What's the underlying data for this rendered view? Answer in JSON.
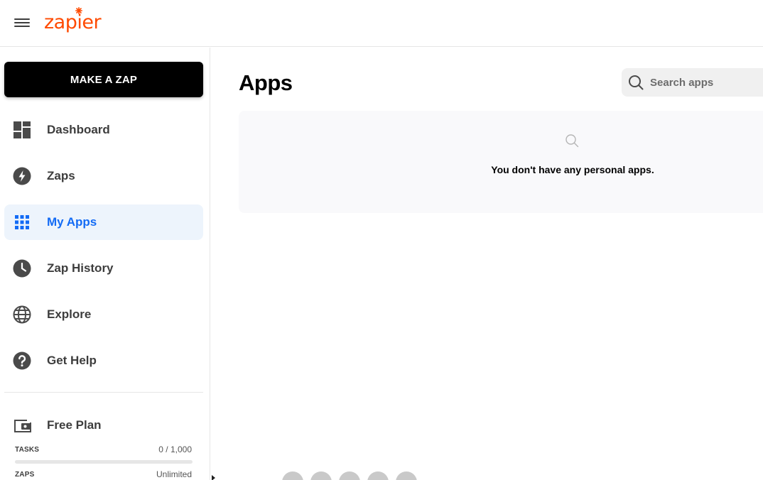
{
  "header": {
    "logo_text": "zapier"
  },
  "sidebar": {
    "make_zap_label": "MAKE A ZAP",
    "items": [
      {
        "label": "Dashboard",
        "icon": "dashboard-icon",
        "active": false
      },
      {
        "label": "Zaps",
        "icon": "bolt-icon",
        "active": false
      },
      {
        "label": "My Apps",
        "icon": "apps-grid-icon",
        "active": true
      },
      {
        "label": "Zap History",
        "icon": "clock-icon",
        "active": false
      },
      {
        "label": "Explore",
        "icon": "globe-icon",
        "active": false
      },
      {
        "label": "Get Help",
        "icon": "help-icon",
        "active": false
      }
    ],
    "plan": {
      "label": "Free Plan",
      "icon": "wallet-icon",
      "tasks_label": "TASKS",
      "tasks_value": "0 / 1,000",
      "tasks_progress": 0,
      "zaps_label": "ZAPS",
      "zaps_value": "Unlimited"
    }
  },
  "main": {
    "title": "Apps",
    "search": {
      "placeholder": "Search apps",
      "value": ""
    },
    "empty_message": "You don't have any personal apps."
  },
  "colors": {
    "brand": "#ff4a00",
    "active_blue": "#136bf5",
    "active_bg": "#edf4fc"
  }
}
